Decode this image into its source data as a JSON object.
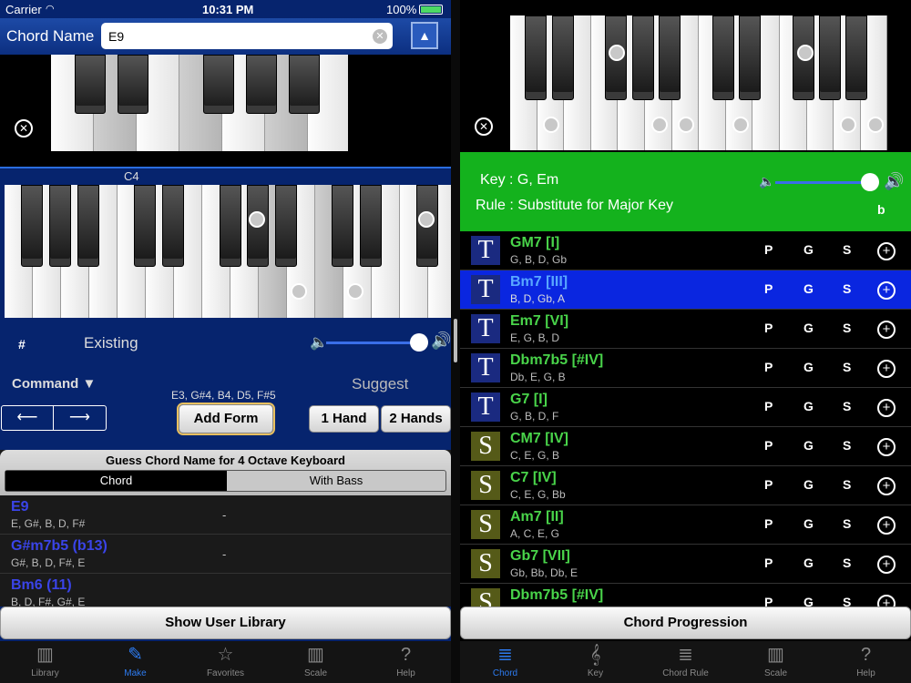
{
  "status": {
    "carrier": "Carrier",
    "time": "10:31 PM",
    "battery": "100%"
  },
  "header": {
    "label": "Chord Name",
    "value": "E9",
    "up_icon": "triangle-up-icon"
  },
  "left": {
    "c4_label": "C4",
    "sharp": "#",
    "existing": "Existing",
    "command": "Command ▼",
    "suggest": "Suggest",
    "notes": "E3, G#4, B4, D5, F#5",
    "add_form": "Add Form",
    "one_hand": "1 Hand",
    "two_hands": "2 Hands",
    "guess_title": "Guess Chord Name for 4 Octave Keyboard",
    "seg_chord": "Chord",
    "seg_bass": "With Bass",
    "guess": [
      {
        "name": "E9",
        "notes": "E, G#, B, D, F#",
        "dash": "-"
      },
      {
        "name": "G#m7b5 (b13)",
        "notes": "G#, B, D, F#, E",
        "dash": "-"
      },
      {
        "name": "Bm6 (11)",
        "notes": "B, D, F#, G#, E",
        "dash": "-"
      }
    ],
    "show_user_library": "Show User Library",
    "tabs": [
      {
        "label": "Library",
        "icon": "library-icon"
      },
      {
        "label": "Make",
        "icon": "pencil-icon"
      },
      {
        "label": "Favorites",
        "icon": "star-icon"
      },
      {
        "label": "Scale",
        "icon": "scale-icon"
      },
      {
        "label": "Help",
        "icon": "question-icon"
      }
    ]
  },
  "right": {
    "key": "Key : G, Em",
    "rule": "Rule : Substitute for Major Key",
    "flat": "b",
    "rows": [
      {
        "badge": "T",
        "name": "GM7 [I]",
        "notes": "G, B, D, Gb",
        "p": "P",
        "g": "G",
        "s": "S"
      },
      {
        "badge": "T",
        "name": "Bm7 [III]",
        "notes": "B, D, Gb, A",
        "p": "P",
        "g": "G",
        "s": "S"
      },
      {
        "badge": "T",
        "name": "Em7 [VI]",
        "notes": "E, G, B, D",
        "p": "P",
        "g": "G",
        "s": "S"
      },
      {
        "badge": "T",
        "name": "Dbm7b5 [#IV]",
        "notes": "Db, E, G, B",
        "p": "P",
        "g": "G",
        "s": "S"
      },
      {
        "badge": "T",
        "name": "G7 [I]",
        "notes": "G, B, D, F",
        "p": "P",
        "g": "G",
        "s": "S"
      },
      {
        "badge": "S",
        "name": "CM7 [IV]",
        "notes": "C, E, G, B",
        "p": "P",
        "g": "G",
        "s": "S"
      },
      {
        "badge": "S",
        "name": "C7 [IV]",
        "notes": "C, E, G, Bb",
        "p": "P",
        "g": "G",
        "s": "S"
      },
      {
        "badge": "S",
        "name": "Am7 [II]",
        "notes": "A, C, E, G",
        "p": "P",
        "g": "G",
        "s": "S"
      },
      {
        "badge": "S",
        "name": "Gb7 [VII]",
        "notes": "Gb, Bb, Db, E",
        "p": "P",
        "g": "G",
        "s": "S"
      },
      {
        "badge": "S",
        "name": "Dbm7b5 [#IV]",
        "notes": "",
        "p": "P",
        "g": "G",
        "s": "S"
      }
    ],
    "chord_progression": "Chord Progression",
    "tabs": [
      {
        "label": "Chord",
        "icon": "chord-icon"
      },
      {
        "label": "Key",
        "icon": "treble-clef-icon"
      },
      {
        "label": "Chord Rule",
        "icon": "chord-rule-icon"
      },
      {
        "label": "Scale",
        "icon": "scale-icon"
      },
      {
        "label": "Help",
        "icon": "question-icon"
      }
    ],
    "selected_row": 1
  },
  "colors": {
    "left_bg": "#06246e",
    "accent": "#2d7bf0",
    "green": "#14b21d",
    "selected": "#0a26e0",
    "chord_name": "#49d44a",
    "guess_name": "#3a44e8"
  }
}
